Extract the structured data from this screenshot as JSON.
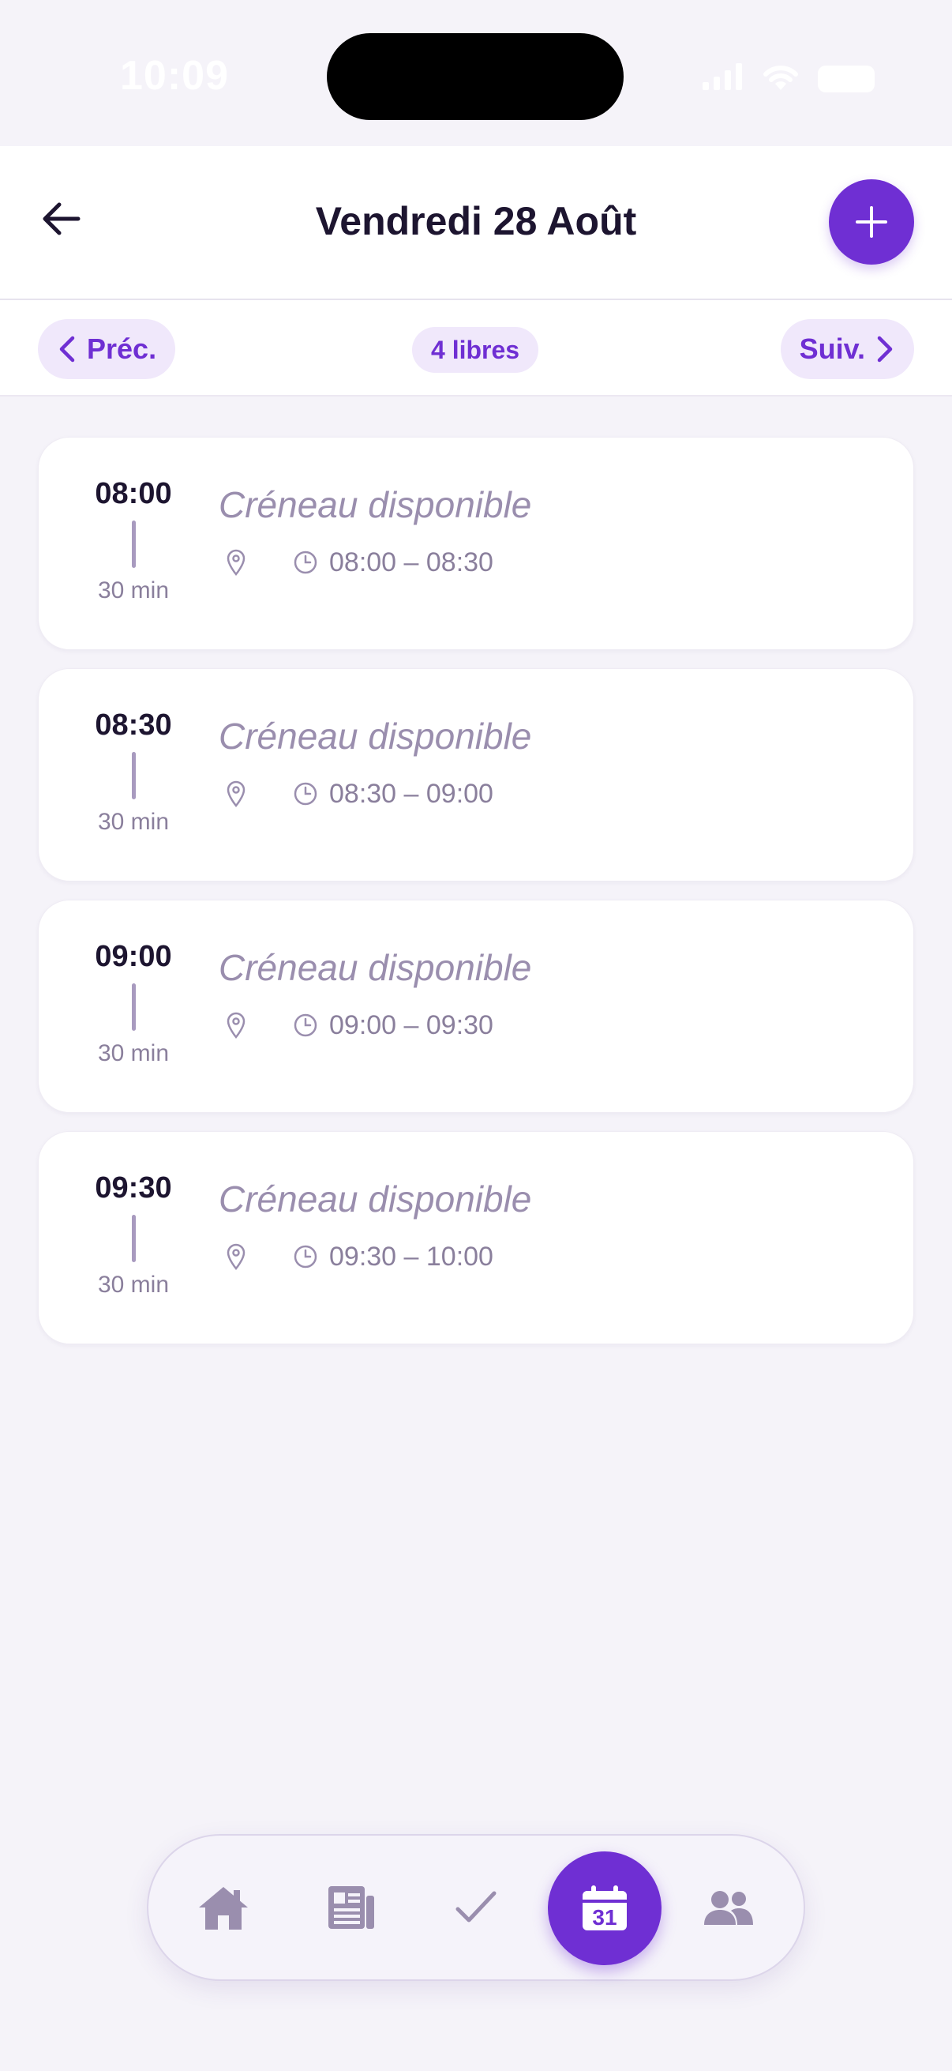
{
  "status": {
    "time": "10:09"
  },
  "header": {
    "title": "Vendredi 28 Août"
  },
  "nav": {
    "prev_label": "Préc.",
    "next_label": "Suiv.",
    "free_count": "4 libres"
  },
  "slots": [
    {
      "start": "08:00",
      "duration": "30 min",
      "title": "Créneau disponible",
      "range": "08:00 – 08:30"
    },
    {
      "start": "08:30",
      "duration": "30 min",
      "title": "Créneau disponible",
      "range": "08:30 – 09:00"
    },
    {
      "start": "09:00",
      "duration": "30 min",
      "title": "Créneau disponible",
      "range": "09:00 – 09:30"
    },
    {
      "start": "09:30",
      "duration": "30 min",
      "title": "Créneau disponible",
      "range": "09:30 – 10:00"
    }
  ],
  "tabbar": {
    "items": [
      "home-icon",
      "newspaper-icon",
      "check-icon",
      "calendar-icon",
      "users-icon"
    ],
    "active": "calendar-icon",
    "calendar_day": "31"
  },
  "colors": {
    "accent": "#6f2fd3",
    "accent_soft": "#f0e8fb",
    "background": "#f5f3f9"
  }
}
